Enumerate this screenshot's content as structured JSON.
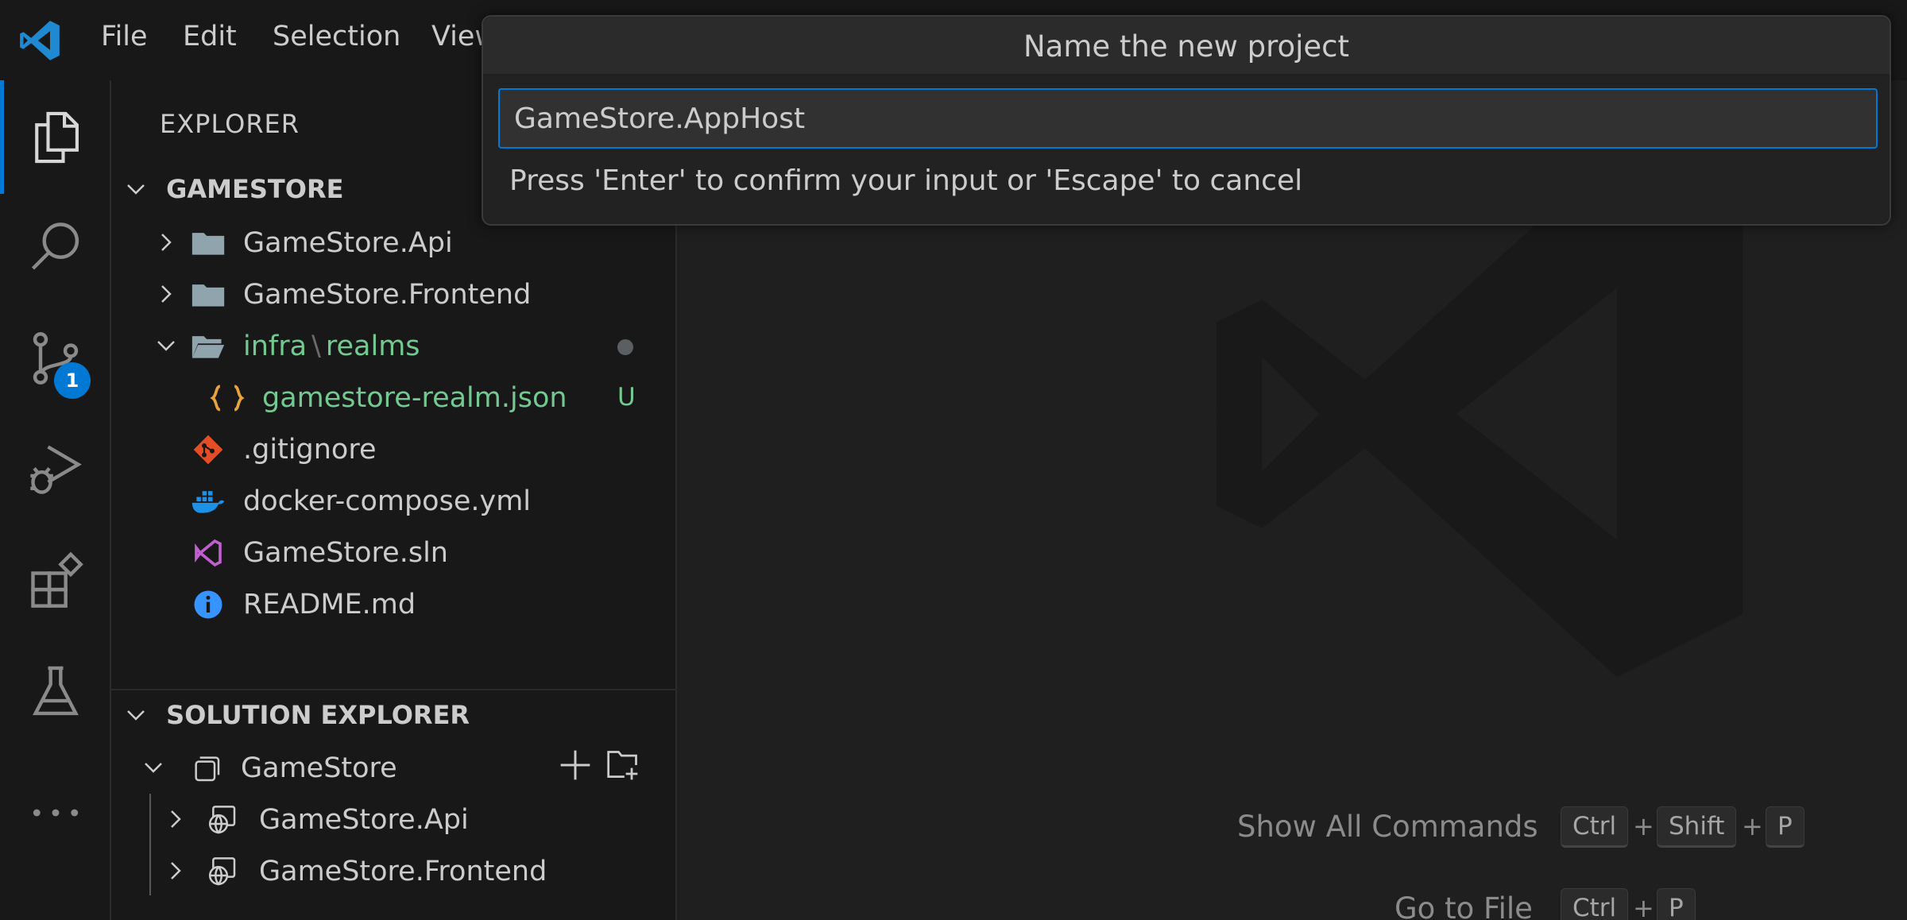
{
  "menu": {
    "file": "File",
    "edit": "Edit",
    "selection": "Selection",
    "view": "View"
  },
  "activity": {
    "source_control_badge": "1"
  },
  "explorer": {
    "title": "EXPLORER",
    "workspace": "GAMESTORE",
    "items": [
      {
        "label": "GameStore.Api"
      },
      {
        "label": "GameStore.Frontend"
      },
      {
        "label_a": "infra",
        "sep": "\\",
        "label_b": "realms"
      },
      {
        "label": "gamestore-realm.json",
        "status": "U"
      },
      {
        "label": ".gitignore"
      },
      {
        "label": "docker-compose.yml"
      },
      {
        "label": "GameStore.sln"
      },
      {
        "label": "README.md"
      }
    ]
  },
  "solution_explorer": {
    "title": "SOLUTION EXPLORER",
    "solution": "GameStore",
    "projects": [
      {
        "label": "GameStore.Api"
      },
      {
        "label": "GameStore.Frontend"
      }
    ]
  },
  "editor": {
    "hints": [
      {
        "label": "Show All Commands",
        "keys": [
          "Ctrl",
          "Shift",
          "P"
        ]
      },
      {
        "label": "Go to File",
        "keys": [
          "Ctrl",
          "P"
        ]
      }
    ],
    "key_separator": "+"
  },
  "quick_input": {
    "title": "Name the new project",
    "value": "GameStore.AppHost",
    "message": "Press 'Enter' to confirm your input or 'Escape' to cancel"
  },
  "colors": {
    "accent": "#0078d4",
    "untracked": "#73c991",
    "folder": "#90a4ae",
    "json": "#e8a33d",
    "git": "#e44d26",
    "docker": "#1d91e6",
    "sln": "#c15fd0",
    "info": "#3794ff"
  }
}
